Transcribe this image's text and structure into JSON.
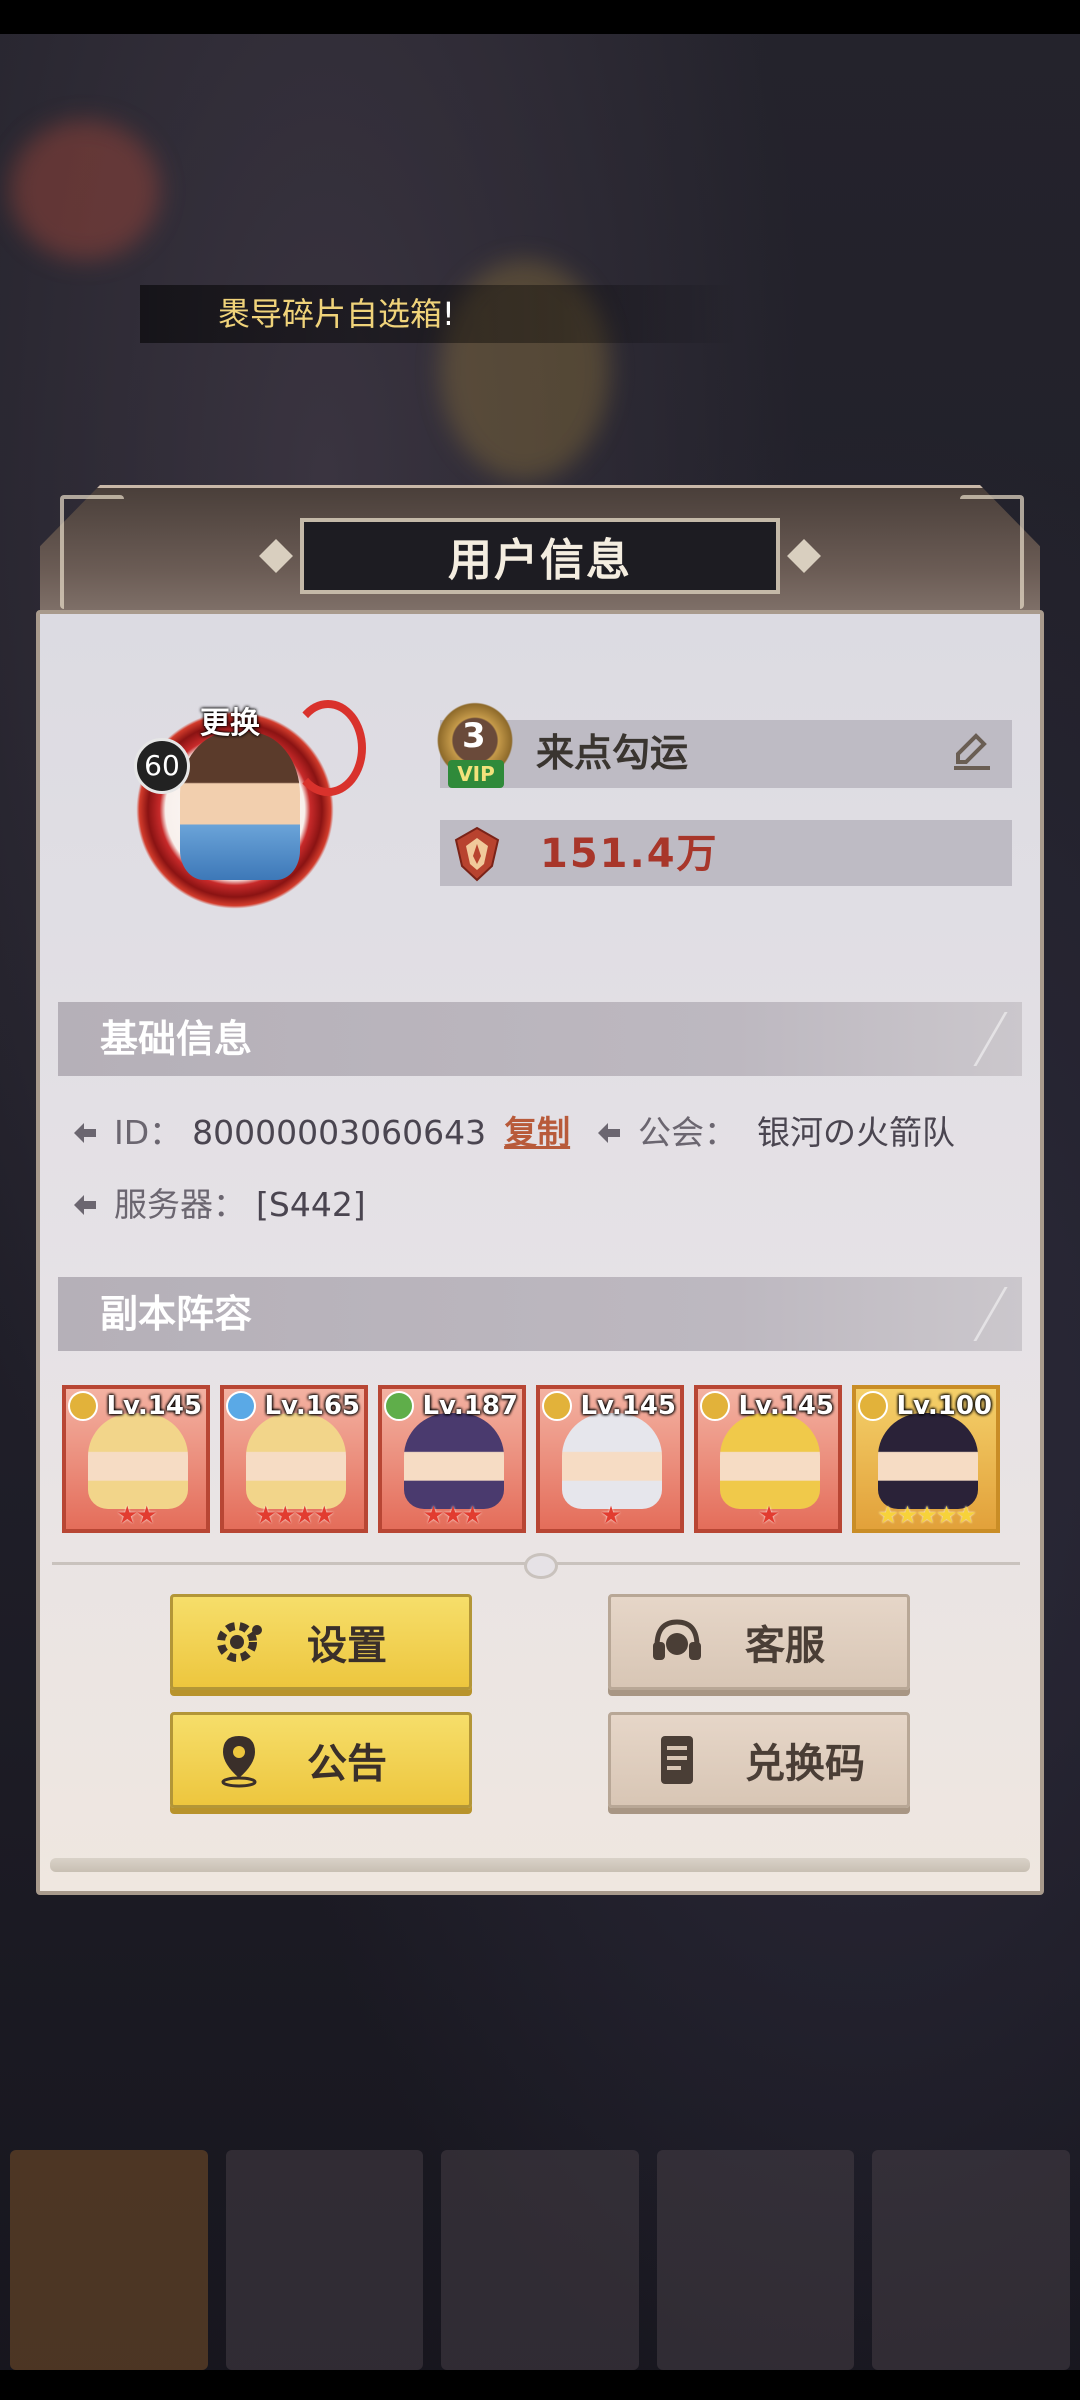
{
  "marquee": {
    "text": "褁导碎片自选箱",
    "tail": "!"
  },
  "dialog": {
    "title": "用户信息",
    "avatar": {
      "level": "60",
      "change_label": "更换"
    },
    "player": {
      "vip_level": "3",
      "vip_label": "VIP",
      "name": "来点勾运",
      "power": "151.4万"
    },
    "basic": {
      "section_title": "基础信息",
      "id_label": "ID：",
      "id_value": "80000003060643",
      "copy_label": "复制",
      "guild_label": "公会：",
      "guild_value": "银河の火箭队",
      "server_label": "服务器：",
      "server_value": "[S442]"
    },
    "lineup": {
      "section_title": "副本阵容",
      "heroes": [
        {
          "level": "Lv.145",
          "stars": 2,
          "star_color": "red",
          "frame": "red",
          "faction_color": "#e2b23a",
          "hair": "#f2d58a"
        },
        {
          "level": "Lv.165",
          "stars": 4,
          "star_color": "red",
          "frame": "red",
          "faction_color": "#5aa9e6",
          "hair": "#f2d58a"
        },
        {
          "level": "Lv.187",
          "stars": 3,
          "star_color": "red",
          "frame": "red",
          "faction_color": "#5fae4a",
          "hair": "#4a3a6e"
        },
        {
          "level": "Lv.145",
          "stars": 1,
          "star_color": "red",
          "frame": "red",
          "faction_color": "#e2b23a",
          "hair": "#e6e6ec"
        },
        {
          "level": "Lv.145",
          "stars": 1,
          "star_color": "red",
          "frame": "red",
          "faction_color": "#e2b23a",
          "hair": "#f0c94a"
        },
        {
          "level": "Lv.100",
          "stars": 5,
          "star_color": "gold",
          "frame": "gold",
          "faction_color": "#e2b23a",
          "hair": "#2a2238"
        }
      ]
    },
    "buttons": {
      "settings": {
        "label": "设置",
        "icon": "gear-icon"
      },
      "support": {
        "label": "客服",
        "icon": "headset-icon"
      },
      "notice": {
        "label": "公告",
        "icon": "location-pin-icon"
      },
      "redeem": {
        "label": "兑换码",
        "icon": "document-icon"
      }
    }
  },
  "colors": {
    "accent_yellow": "#edc63e",
    "power_red": "#a8362a",
    "frame_red": "#b84634"
  }
}
